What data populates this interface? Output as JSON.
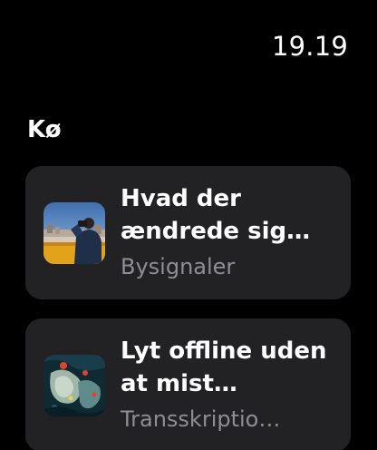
{
  "status_bar": {
    "time": "19.19"
  },
  "queue": {
    "title": "Kø",
    "items": [
      {
        "title": "Hvad der ændrede sig…",
        "subtitle": "Bysignaler",
        "artwork_icon": "city-photographer-artwork"
      },
      {
        "title": "Lyt offline uden at mist…",
        "subtitle": "Transskriptio…",
        "artwork_icon": "abstract-map-artwork"
      }
    ]
  },
  "colors": {
    "background": "#000000",
    "card": "#222224",
    "text_primary": "#ffffff",
    "text_secondary": "#8e8e93"
  }
}
